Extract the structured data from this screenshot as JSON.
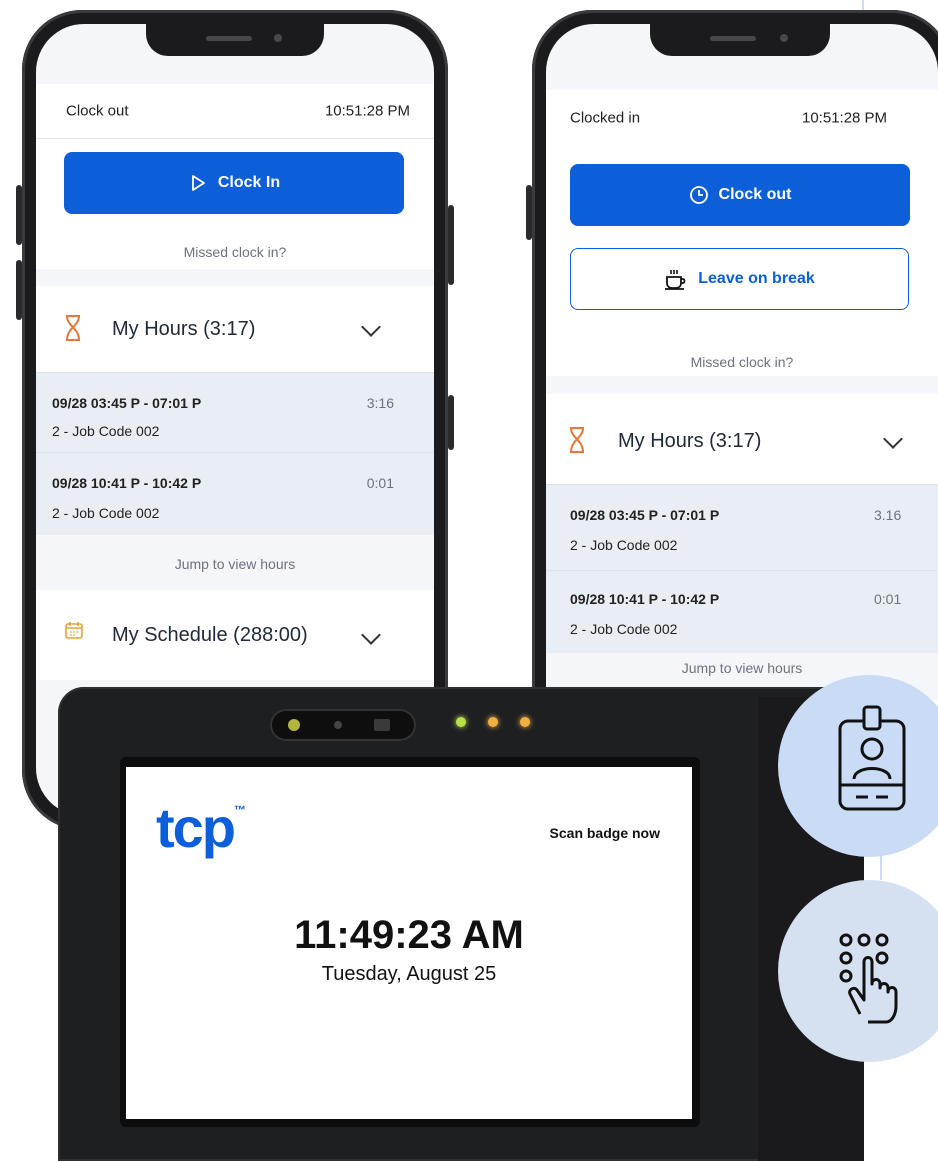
{
  "left_phone": {
    "status_label": "Clock out",
    "time": "10:51:28 PM",
    "clock_button_label": "Clock In",
    "missed_link": "Missed clock in?",
    "hours_title": "My Hours (3:17)",
    "entries": [
      {
        "range": "09/28 03:45 P - 07:01 P",
        "job": "2 - Job Code 002",
        "duration": "3:16"
      },
      {
        "range": "09/28 10:41 P - 10:42 P",
        "job": "2 - Job Code 002",
        "duration": "0:01"
      }
    ],
    "jump_link": "Jump to view hours",
    "schedule_title": "My Schedule (288:00)"
  },
  "right_phone": {
    "status_label": "Clocked in",
    "time": "10:51:28 PM",
    "clock_button_label": "Clock out",
    "break_button_label": "Leave on break",
    "missed_link": "Missed clock in?",
    "hours_title": "My Hours (3:17)",
    "entries": [
      {
        "range": "09/28 03:45 P - 07:01 P",
        "job": "2 - Job Code 002",
        "duration": "3.16"
      },
      {
        "range": "09/28 10:41 P - 10:42 P",
        "job": "2 - Job Code 002",
        "duration": "0:01"
      }
    ],
    "jump_link": "Jump to view hours"
  },
  "device": {
    "logo": "tcp",
    "logo_tm": "™",
    "prompt": "Scan badge now",
    "time": "11:49:23 AM",
    "date": "Tuesday, August 25"
  },
  "icons": {
    "badge": "badge-icon",
    "keypad": "keypad-touch-icon"
  },
  "colors": {
    "primary": "#0c5fd8",
    "accent_orange": "#e8753a",
    "circle_top": "#c9dbf5",
    "circle_bottom": "#d5e1f1"
  }
}
